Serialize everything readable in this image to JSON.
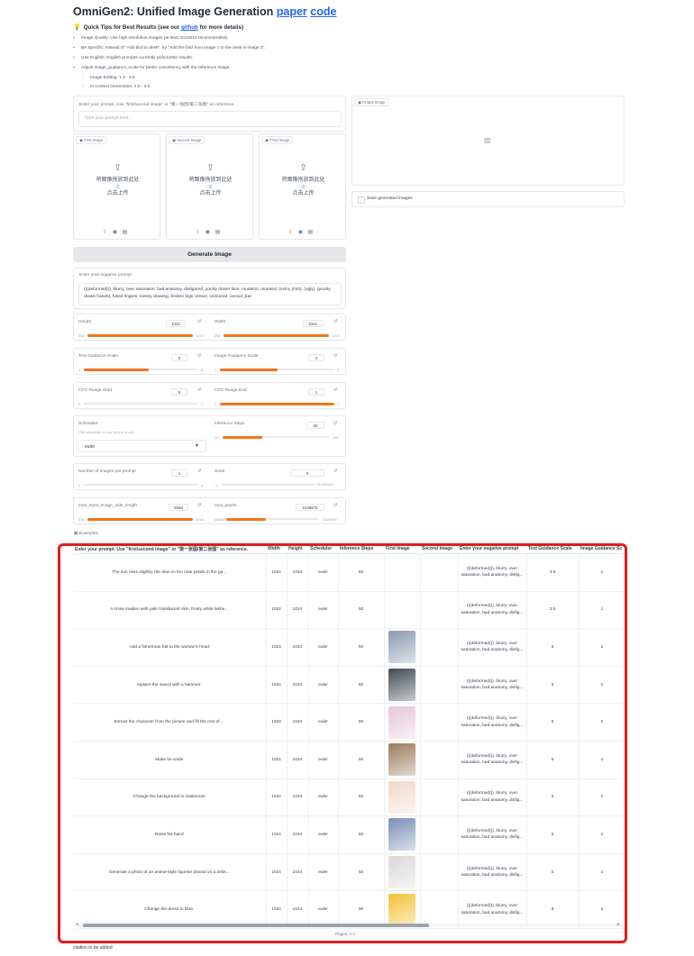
{
  "header": {
    "title": "OmniGen2: Unified Image Generation",
    "paper_link": "paper",
    "code_link": "code"
  },
  "tips": {
    "heading": "Quick Tips for Best Results (see our",
    "github": "github",
    "heading_end": "for more details)",
    "items": [
      "Image Quality: Use high-resolution images (at least 512x512 recommended).",
      "Be Specific: Instead of \"Add bird to desk\", try \"Add the bird from image 1 to the desk in image 2\".",
      "Use English: English prompts currently yield better results.",
      "Adjust image_guidance_scale for better consistency with the reference image:"
    ],
    "subitems": [
      "Image Editing: 1.3 - 2.0",
      "In-context Generation: 2.0 - 3.0"
    ]
  },
  "prompt": {
    "label": "Enter your prompt. Use \"first/second image\" or \"第一张图/第二张图\" as reference.",
    "placeholder": "Type your prompt here..."
  },
  "uploads": [
    {
      "label": "First Image",
      "line1": "将图像拖放到此处",
      "line2": "- 或 -",
      "line3": "点击上传"
    },
    {
      "label": "Second Image",
      "line1": "将图像拖放到此处",
      "line2": "- 或 -",
      "line3": "点击上传"
    },
    {
      "label": "Third Image",
      "line1": "将图像拖放到此处",
      "line2": "- 或 -",
      "line3": "点击上传"
    }
  ],
  "output": {
    "label": "Output Image",
    "save_label": "Save generated images"
  },
  "generate_button": "Generate Image",
  "negative": {
    "label": "Enter your negative prompt",
    "value": "(((deformed))), blurry, over saturation, bad anatomy, disfigured, poorly drawn face, mutation, mutated, (extra_limb), (ugly), (poorly drawn hands), fused fingers, messy drawing, broken legs censor, censored, censor_bar"
  },
  "sliders": {
    "height": {
      "label": "Height",
      "value": "1024",
      "min": "256",
      "max": "1024",
      "fraction": 1.0
    },
    "width": {
      "label": "Width",
      "value": "1024",
      "min": "256",
      "max": "1024",
      "fraction": 1.0
    },
    "text_guidance": {
      "label": "Text Guidance Scale",
      "value": "5",
      "min": "1",
      "max": "8",
      "fraction": 0.571
    },
    "image_guidance": {
      "label": "Image Guidance Scale",
      "value": "2",
      "min": "1",
      "max": "3",
      "fraction": 0.5
    },
    "cfg_start": {
      "label": "CFG Range Start",
      "value": "0",
      "min": "0",
      "max": "1",
      "fraction": 0.0
    },
    "cfg_end": {
      "label": "CFG Range End",
      "value": "1",
      "min": "0",
      "max": "1",
      "fraction": 1.0
    },
    "steps": {
      "label": "Inference Steps",
      "value": "50",
      "min": "20",
      "max": "100",
      "fraction": 0.375
    },
    "num_images": {
      "label": "Number of images per prompt",
      "value": "1",
      "min": "1",
      "max": "4",
      "fraction": 0.0
    },
    "seed": {
      "label": "Seed",
      "value": "0",
      "min": "-1",
      "max": "2147483647",
      "fraction": 0.0
    },
    "max_side": {
      "label": "max_input_image_side_length",
      "value": "2048",
      "min": "256",
      "max": "2048",
      "fraction": 1.0
    },
    "max_pixels": {
      "label": "max_pixels",
      "value": "1048576",
      "min": "65536",
      "max": "2359296",
      "fraction": 0.43
    }
  },
  "scheduler": {
    "label": "Scheduler",
    "info": "The scheduler to use for the model.",
    "value": "euler"
  },
  "examples": {
    "label": "Examples",
    "headers": [
      "Enter your prompt. Use \"first/second image\" or \"第一张图/第二张图\" as reference.",
      "Width",
      "Height",
      "Scheduler",
      "Inference Steps",
      "First Image",
      "Second Image",
      "Enter your negative prompt",
      "Text Guidance Scale",
      "Image Guidance Sc"
    ],
    "rows": [
      {
        "prompt": "The sun rises slightly, the dew on the rose petals in the ga...",
        "width": "1024",
        "height": "1024",
        "scheduler": "euler",
        "steps": "50",
        "image": "",
        "neg": "(((deformed))), blurry, over saturation, bad anatomy, disfig...",
        "tgs": "3.5",
        "igs": "1"
      },
      {
        "prompt": "A snow maiden with pale translucent skin, frosty white lashe...",
        "width": "1024",
        "height": "1024",
        "scheduler": "euler",
        "steps": "50",
        "image": "",
        "neg": "(((deformed))), blurry, over saturation, bad anatomy, disfig...",
        "tgs": "3.5",
        "igs": "1"
      },
      {
        "prompt": "Add a fisherman hat to the woman's head",
        "width": "1024",
        "height": "1024",
        "scheduler": "euler",
        "steps": "50",
        "image": "#8b9bb0",
        "neg": "(((deformed))), blurry, over saturation, bad anatomy, disfig...",
        "tgs": "5",
        "igs": "2"
      },
      {
        "prompt": "replace the sword with a hammer.",
        "width": "1024",
        "height": "1024",
        "scheduler": "euler",
        "steps": "50",
        "image": "#3f4a4f",
        "neg": "(((deformed))), blurry, over saturation, bad anatomy, disfig...",
        "tgs": "5",
        "igs": "2"
      },
      {
        "prompt": "Extract the character from the picture and fill the rest of ...",
        "width": "1024",
        "height": "1024",
        "scheduler": "euler",
        "steps": "50",
        "image": "#e8c7d8",
        "neg": "(((deformed))), blurry, over saturation, bad anatomy, disfig...",
        "tgs": "5",
        "igs": "2"
      },
      {
        "prompt": "Make he smile",
        "width": "1024",
        "height": "1024",
        "scheduler": "euler",
        "steps": "50",
        "image": "#9a7b5c",
        "neg": "(((deformed))), blurry, over saturation, bad anatomy, disfig...",
        "tgs": "5",
        "igs": "2"
      },
      {
        "prompt": "Change the background to classroom",
        "width": "1024",
        "height": "1024",
        "scheduler": "euler",
        "steps": "50",
        "image": "#f1d9c9",
        "neg": "(((deformed))), blurry, over saturation, bad anatomy, disfig...",
        "tgs": "5",
        "igs": "2"
      },
      {
        "prompt": "Raise his hand",
        "width": "1024",
        "height": "1024",
        "scheduler": "euler",
        "steps": "50",
        "image": "#7a8fb5",
        "neg": "(((deformed))), blurry, over saturation, bad anatomy, disfig...",
        "tgs": "5",
        "igs": "2"
      },
      {
        "prompt": "Generate a photo of an anime-style figurine placed on a desk...",
        "width": "1024",
        "height": "1024",
        "scheduler": "euler",
        "steps": "50",
        "image": "#d9d9dc",
        "neg": "(((deformed))), blurry, over saturation, bad anatomy, disfig...",
        "tgs": "5",
        "igs": "2"
      },
      {
        "prompt": "Change the dress to blue.",
        "width": "1024",
        "height": "1024",
        "scheduler": "euler",
        "steps": "50",
        "image": "#f2c233",
        "neg": "(((deformed))), blurry, over saturation, bad anatomy, disfig...",
        "tgs": "5",
        "igs": "2"
      }
    ],
    "pages_label": "Pages:",
    "page1": "1",
    "page2": "2"
  },
  "footer": {
    "citation": "citation to be added"
  },
  "colors": {
    "accent": "#f97316",
    "link": "#2563eb",
    "highlight": "#e11d1d"
  },
  "icons": {
    "upload": "upload-icon",
    "webcam": "webcam-icon",
    "clipboard": "clipboard-icon",
    "image_placeholder": "image-icon",
    "reset": "reset-icon",
    "dropdown": "chevron-down-icon"
  }
}
